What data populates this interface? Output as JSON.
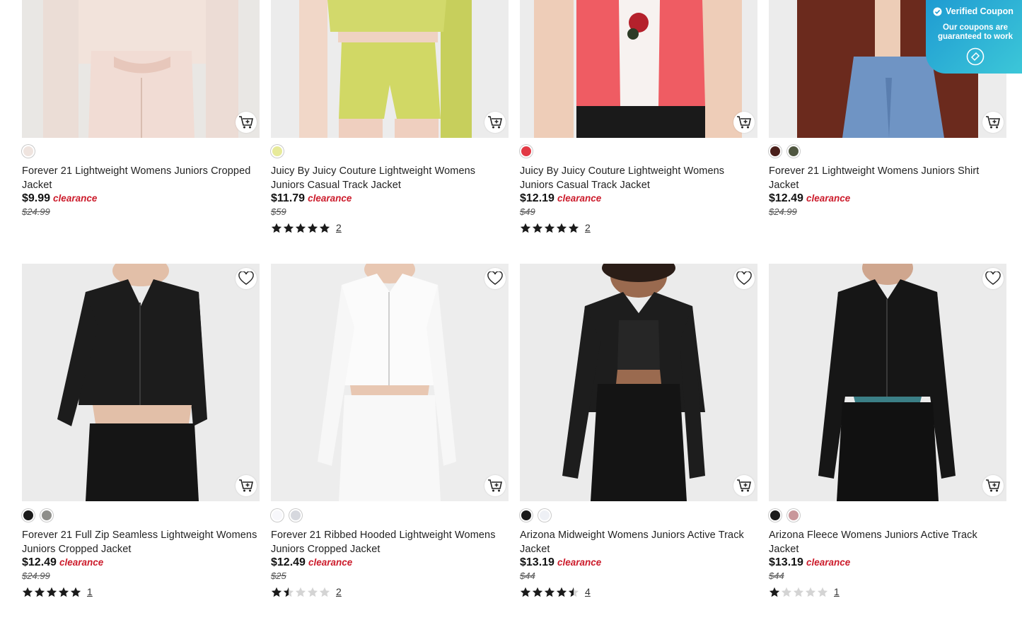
{
  "coupon_widget": {
    "title": "Verified Coupon",
    "subtitle": "Our coupons are guaranteed to work"
  },
  "products": [
    {
      "title": "Forever 21 Lightweight Womens Juniors Cropped Jacket",
      "price": "$9.99",
      "tag": "clearance",
      "was": "$24.99",
      "swatches": [
        "#efe4df"
      ],
      "rating": null,
      "review_count": ""
    },
    {
      "title": "Juicy By Juicy Couture Lightweight Womens Juniors Casual Track Jacket",
      "price": "$11.79",
      "tag": "clearance",
      "was": "$59",
      "swatches": [
        "#e7ea9a"
      ],
      "rating": 5,
      "review_count": "2"
    },
    {
      "title": "Juicy By Juicy Couture Lightweight Womens Juniors Casual Track Jacket",
      "price": "$12.19",
      "tag": "clearance",
      "was": "$49",
      "swatches": [
        "#e23a45"
      ],
      "rating": 5,
      "review_count": "2"
    },
    {
      "title": "Forever 21 Lightweight Womens Juniors Shirt Jacket",
      "price": "$12.49",
      "tag": "clearance",
      "was": "$24.99",
      "swatches": [
        "#4a1f1a",
        "#4f5640"
      ],
      "rating": null,
      "review_count": ""
    },
    {
      "title": "Forever 21 Full Zip Seamless Lightweight Womens Juniors Cropped Jacket",
      "price": "$12.49",
      "tag": "clearance",
      "was": "$24.99",
      "swatches": [
        "#1b1b1b",
        "#8e8e8a"
      ],
      "rating": 5,
      "review_count": "1"
    },
    {
      "title": "Forever 21 Ribbed Hooded Lightweight Womens Juniors Cropped Jacket",
      "price": "$12.49",
      "tag": "clearance",
      "was": "$25",
      "swatches": [
        "#f7f7fb",
        "#d6d8de"
      ],
      "rating": 1.5,
      "review_count": "2"
    },
    {
      "title": "Arizona Midweight Womens Juniors Active Track Jacket",
      "price": "$13.19",
      "tag": "clearance",
      "was": "$44",
      "swatches": [
        "#1b1b1b",
        "#eef0f5"
      ],
      "rating": 4.5,
      "review_count": "4"
    },
    {
      "title": "Arizona Fleece Womens Juniors Active Track Jacket",
      "price": "$13.19",
      "tag": "clearance",
      "was": "$44",
      "swatches": [
        "#1b1b1b",
        "#c9979b"
      ],
      "rating": 1,
      "review_count": "1"
    }
  ]
}
